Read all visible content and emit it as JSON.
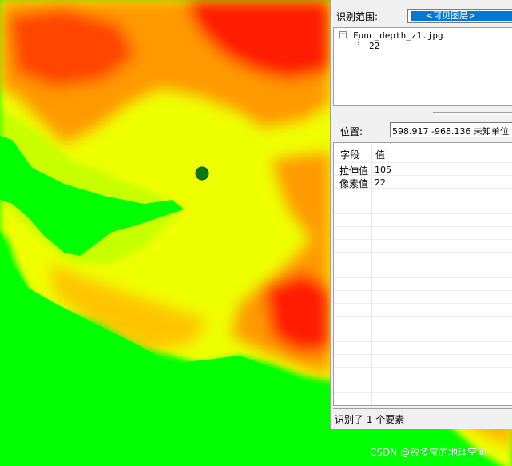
{
  "colors": {
    "green": "#00ff00",
    "yellow": "#f0ff00",
    "orange": "#ff8800",
    "red": "#ff0000",
    "marker": "#0a7a0a",
    "selection": "#0078d7"
  },
  "identify": {
    "range_label": "识别范围:",
    "range_value": "<可见图层>",
    "tree": {
      "root": "Func_depth_z1.jpg",
      "child": "22"
    },
    "position_label": "位置:",
    "position_value": "598.917  -968.136 未知单位",
    "table": {
      "headers": {
        "field": "字段",
        "value": "值"
      },
      "rows": [
        {
          "field": "拉伸值",
          "value": "105"
        },
        {
          "field": "像素值",
          "value": "22"
        }
      ]
    },
    "status": "识别了 1 个要素"
  },
  "watermark": "CSDN @锐多宝的地理空间"
}
